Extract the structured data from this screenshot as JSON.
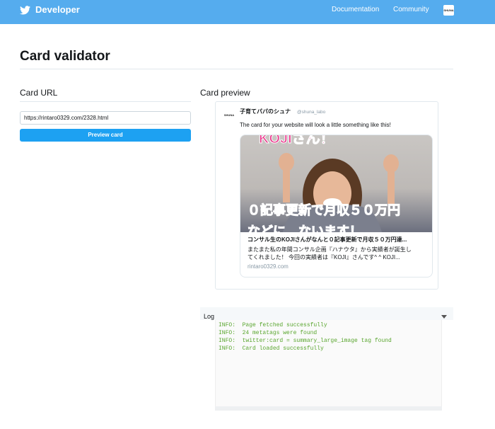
{
  "header": {
    "brand": "Developer",
    "nav": [
      "Documentation",
      "Community"
    ],
    "avatar_text": "SHUNA"
  },
  "page": {
    "title": "Card validator"
  },
  "card_url": {
    "heading": "Card URL",
    "input_value": "https://rintaro0329.com/2328.html",
    "button_label": "Preview card"
  },
  "card_preview": {
    "heading": "Card preview",
    "avatar_text": "SHUNA",
    "name": "子育てパパのシュナ",
    "handle": "@shuna_labo",
    "text": "The card for your website will look a little something like this!",
    "image": {
      "top_caption": "KOJIさん！",
      "main_caption": "０記事更新で月収５０万円",
      "bottom_caption": "などに…ないます！"
    },
    "card_title": "コンサル生のKOJIさんがなんと０記事更新で月収５０万円達...",
    "card_desc_1": "またまた私の年間コンサル企画『ハナウタ』から実績者が誕生し",
    "card_desc_2": "てくれました！ 今回の実績者は『KOJI』さんです^ ^ KOJI...",
    "domain": "rintaro0329.com"
  },
  "log": {
    "label": "Log",
    "lines": [
      "INFO:  Page fetched successfully",
      "INFO:  24 metatags were found",
      "INFO:  twitter:card = summary_large_image tag found",
      "INFO:  Card loaded successfully"
    ]
  }
}
